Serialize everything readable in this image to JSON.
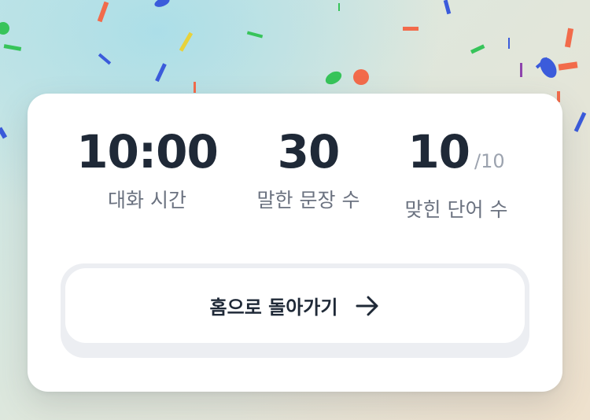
{
  "colors": {
    "confetti": [
      "#f26b4b",
      "#3b5bdb",
      "#37c45a",
      "#e8d23a",
      "#8e44ad"
    ],
    "card": "#ffffff",
    "text_primary": "#1f2937",
    "text_secondary": "#6b7280"
  },
  "stats": {
    "duration": {
      "value": "10:00",
      "label": "대화 시간"
    },
    "sentences": {
      "value": "30",
      "label": "말한 문장 수"
    },
    "words": {
      "value": "10",
      "suffix": "/10",
      "label": "맞힌 단어 수"
    }
  },
  "home_button": {
    "label": "홈으로 돌아가기",
    "icon": "arrow-right-icon"
  }
}
